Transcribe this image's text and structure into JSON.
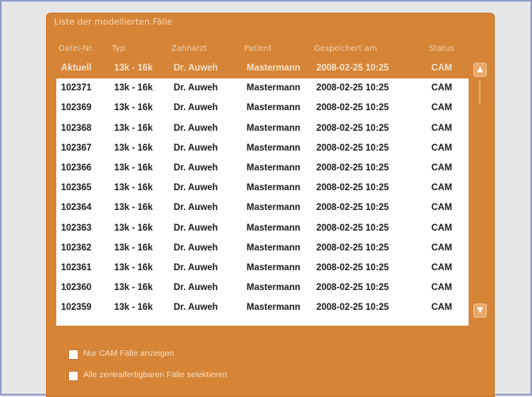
{
  "panel": {
    "title": "Liste der modellierten Fälle",
    "columns": [
      "Datei-Nr.",
      "Typ",
      "Zahnarzt",
      "Patient",
      "Gespeichert am",
      "Status"
    ]
  },
  "rows": [
    [
      "Aktuell",
      "13k - 16k",
      "Dr. Auweh",
      "Mastermann",
      "2008-02-25 10:25",
      "CAM"
    ],
    [
      "102371",
      "13k - 16k",
      "Dr. Auweh",
      "Mastermann",
      "2008-02-25 10:25",
      "CAM"
    ],
    [
      "102369",
      "13k - 16k",
      "Dr. Auweh",
      "Mastermann",
      "2008-02-25 10:25",
      "CAM"
    ],
    [
      "102368",
      "13k - 16k",
      "Dr. Auweh",
      "Mastermann",
      "2008-02-25 10:25",
      "CAM"
    ],
    [
      "102367",
      "13k - 16k",
      "Dr. Auweh",
      "Mastermann",
      "2008-02-25 10:25",
      "CAM"
    ],
    [
      "102366",
      "13k - 16k",
      "Dr. Auweh",
      "Mastermann",
      "2008-02-25 10:25",
      "CAM"
    ],
    [
      "102365",
      "13k - 16k",
      "Dr. Auweh",
      "Mastermann",
      "2008-02-25 10:25",
      "CAM"
    ],
    [
      "102364",
      "13k - 16k",
      "Dr. Auweh",
      "Mastermann",
      "2008-02-25 10:25",
      "CAM"
    ],
    [
      "102363",
      "13k - 16k",
      "Dr. Auweh",
      "Mastermann",
      "2008-02-25 10:25",
      "CAM"
    ],
    [
      "102362",
      "13k - 16k",
      "Dr. Auweh",
      "Mastermann",
      "2008-02-25 10:25",
      "CAM"
    ],
    [
      "102361",
      "13k - 16k",
      "Dr. Auweh",
      "Mastermann",
      "2008-02-25 10:25",
      "CAM"
    ],
    [
      "102360",
      "13k - 16k",
      "Dr. Auweh",
      "Mastermann",
      "2008-02-25 10:25",
      "CAM"
    ],
    [
      "102359",
      "13k - 16k",
      "Dr. Auweh",
      "Mastermann",
      "2008-02-25 10:25",
      "CAM"
    ]
  ],
  "selected_row": 0,
  "options": {
    "cam_only_label": "Nur CAM Fälle anzeigen",
    "select_all_label": "Alle zentralfertigbaren Fälle selektieren"
  },
  "icons": {
    "scroll_up": "chevron-up-icon",
    "scroll_down": "chevron-down-icon"
  },
  "colors": {
    "panel": "#d68436",
    "selected_row": "#d68436",
    "list_background": "#ffffff"
  }
}
